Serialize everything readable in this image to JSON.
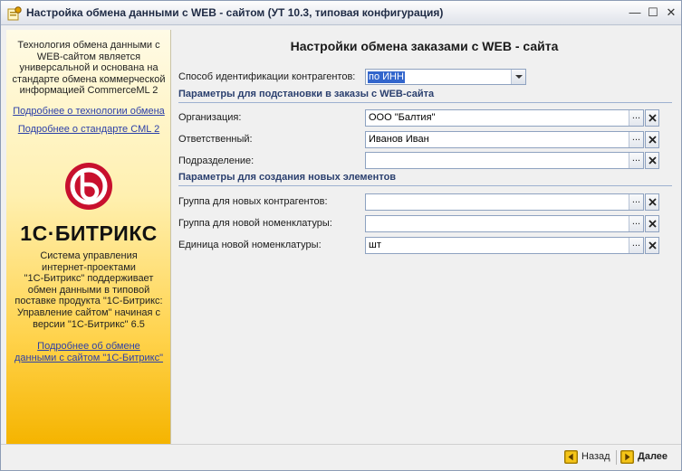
{
  "window": {
    "title": "Настройка обмена данными с WEB - сайтом (УТ 10.3, типовая конфигурация)",
    "buttons": {
      "minimize": "—",
      "maximize": "☐",
      "close": "✕"
    }
  },
  "left_panel": {
    "intro_lines": [
      "Технология обмена данными с",
      "WEB-сайтом является",
      "универсальной и основана на",
      "стандарте обмена коммерческой",
      "информацией CommerceML 2"
    ],
    "link_technology": "Подробнее о технологии обмена",
    "link_standard": "Подробнее о стандарте CML 2",
    "logo_text": "1С·БИТРИКС",
    "description_lines": [
      "Система управления",
      "интернет-проектами",
      "\"1С-Битрикс\" поддерживает",
      "обмен данными в типовой",
      "поставке продукта \"1С-Битрикс:",
      "Управление сайтом\" начиная с",
      "версии \"1С-Битрикс\" 6.5"
    ],
    "link_bitrix_lines": [
      "Подробнее об обмене",
      "данными с сайтом \"1С-Битрикс\""
    ],
    "colors": {
      "logo_red": "#c8102e",
      "panel_bottom": "#f5b400"
    }
  },
  "main": {
    "title": "Настройки обмена заказами с WEB - сайта",
    "identification": {
      "label": "Способ идентификации контрагентов:",
      "value": "по ИНН"
    },
    "section_orders": "Параметры для подстановки в заказы с WEB-сайта",
    "fields_orders": [
      {
        "label": "Организация:",
        "value": "ООО \"Балтия\""
      },
      {
        "label": "Ответственный:",
        "value": "Иванов Иван"
      },
      {
        "label": "Подразделение:",
        "value": ""
      }
    ],
    "section_new": "Параметры для создания новых элементов",
    "fields_new": [
      {
        "label": "Группа для новых контрагентов:",
        "value": ""
      },
      {
        "label": "Группа для новой номенклатуры:",
        "value": ""
      },
      {
        "label": "Единица новой номенклатуры:",
        "value": "шт"
      }
    ],
    "select_button": "..."
  },
  "footer": {
    "back_label": "Назад",
    "next_label": "Далее"
  }
}
